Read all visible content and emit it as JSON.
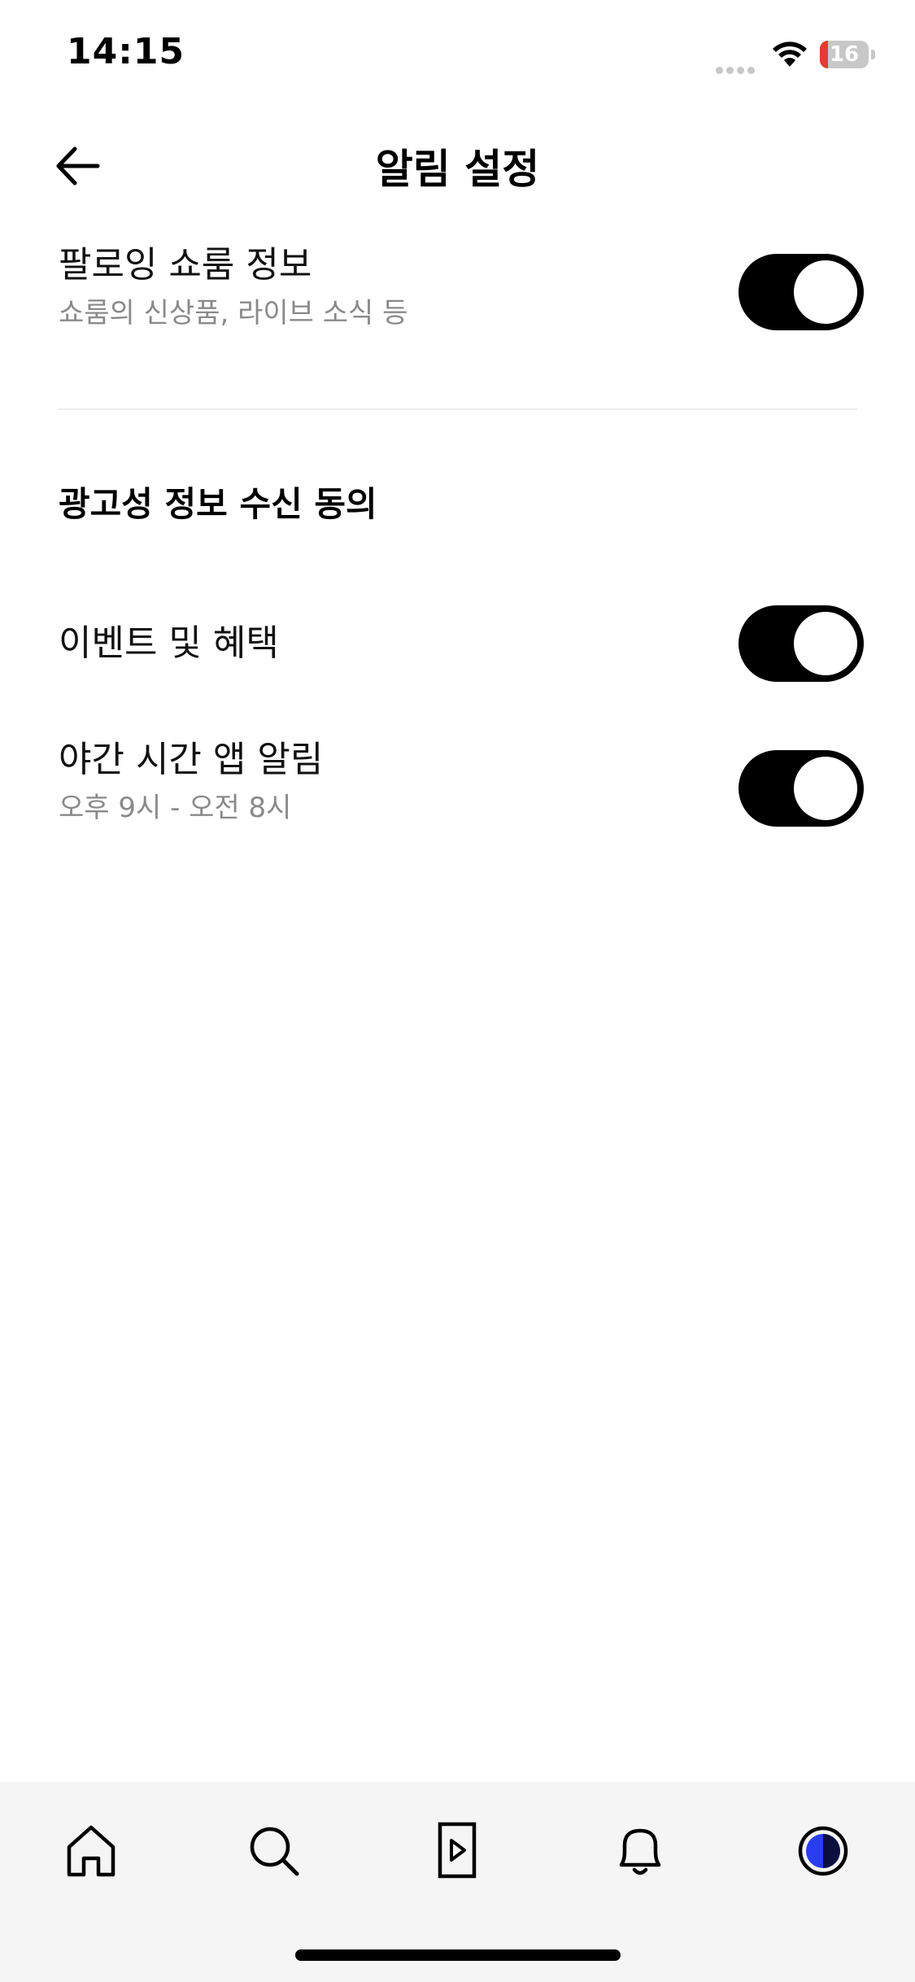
{
  "status_bar": {
    "time": "14:15",
    "battery_level": "16",
    "battery_fraction": 0.16
  },
  "header": {
    "title": "알림 설정",
    "back_icon": "arrow-left-icon"
  },
  "settings": [
    {
      "title": "팔로잉 쇼룸 정보",
      "subtitle": "쇼룸의 신상품, 라이브 소식 등",
      "enabled": true
    },
    {
      "title": "이벤트 및 혜택",
      "subtitle": "",
      "enabled": true
    },
    {
      "title": "야간 시간 앱 알림",
      "subtitle": "오후 9시 - 오전 8시",
      "enabled": true
    }
  ],
  "section": {
    "title": "광고성 정보 수신 동의"
  },
  "tab_bar": {
    "items": [
      {
        "icon": "home-icon"
      },
      {
        "icon": "search-icon"
      },
      {
        "icon": "video-play-icon"
      },
      {
        "icon": "bell-icon"
      },
      {
        "icon": "profile-avatar-icon"
      }
    ]
  },
  "colors": {
    "toggle_on": "#000000",
    "battery_low": "#e53b30",
    "avatar_accent": "#2b3cf5"
  }
}
